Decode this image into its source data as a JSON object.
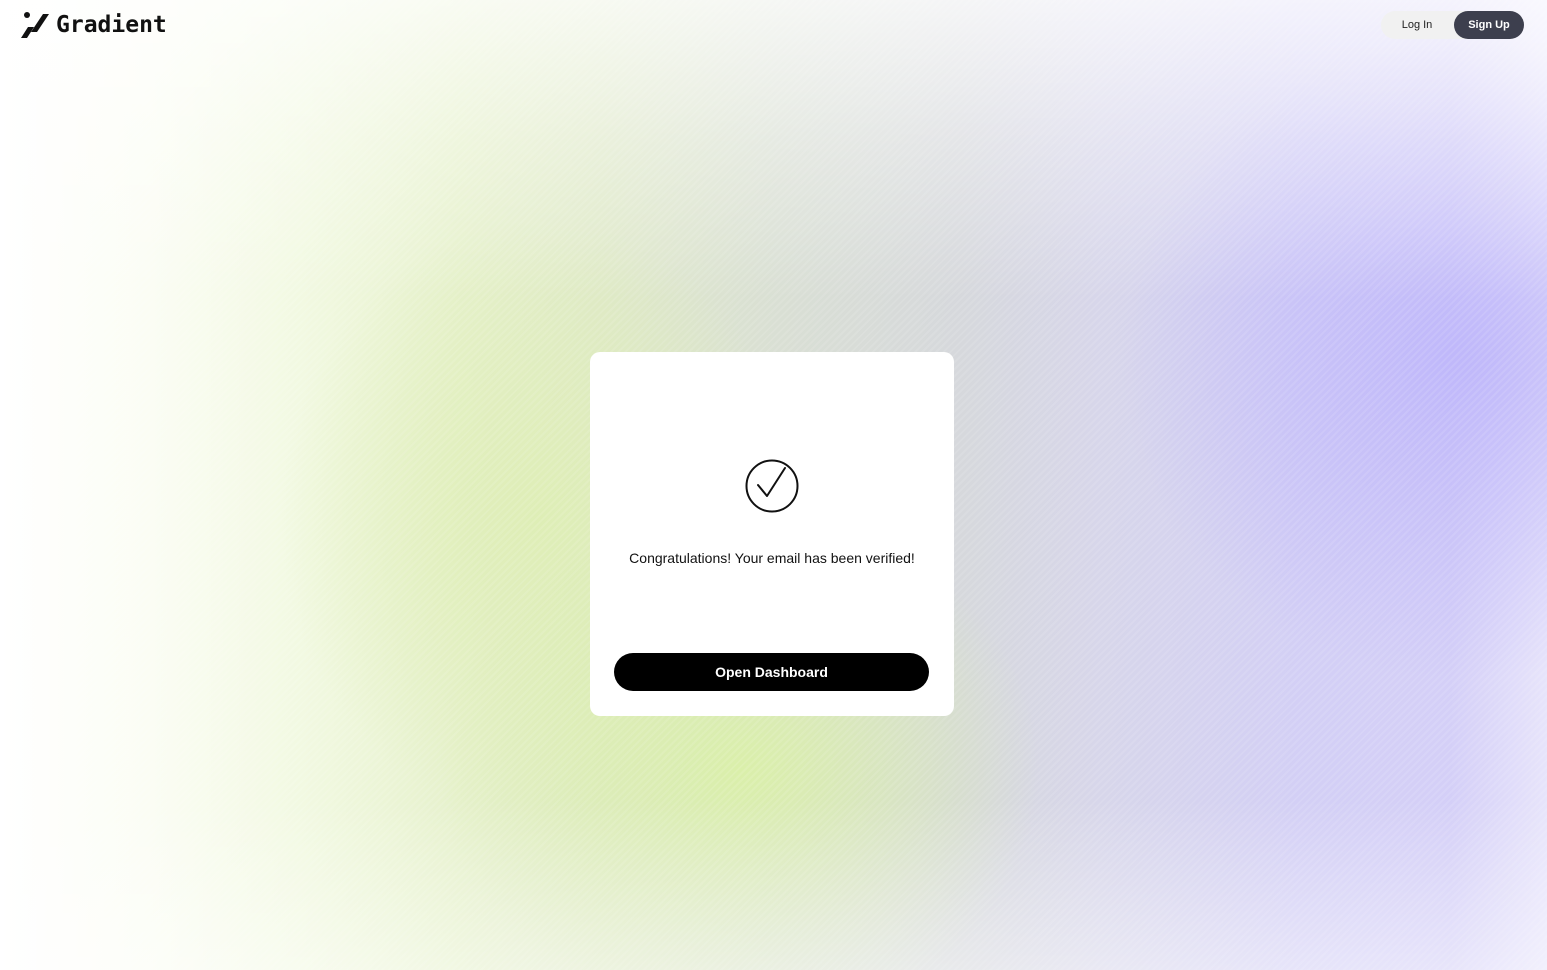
{
  "brand": {
    "name": "Gradient",
    "logo_icon": "gradient-logo-icon"
  },
  "header": {
    "login_label": "Log In",
    "signup_label": "Sign Up"
  },
  "verification": {
    "icon": "check-circle-icon",
    "message": "Congratulations! Your email has been verified!",
    "button_label": "Open Dashboard"
  },
  "colors": {
    "signup_bg": "#3d3f4e",
    "primary_button": "#000000",
    "card_bg": "#ffffff"
  }
}
